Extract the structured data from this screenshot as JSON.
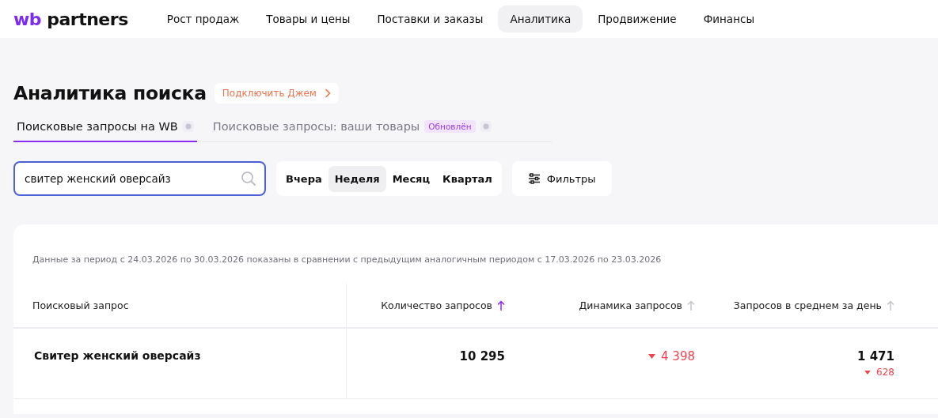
{
  "logo": {
    "brand": "wb",
    "name": "partners"
  },
  "nav": [
    {
      "label": "Рост продаж",
      "selected": false
    },
    {
      "label": "Товары и цены",
      "selected": false
    },
    {
      "label": "Поставки и заказы",
      "selected": false
    },
    {
      "label": "Аналитика",
      "selected": true
    },
    {
      "label": "Продвижение",
      "selected": false
    },
    {
      "label": "Финансы",
      "selected": false
    }
  ],
  "page_title": "Аналитика поиска",
  "promo_button": "Подключить Джем",
  "tabs": [
    {
      "label": "Поисковые запросы на WB",
      "selected": true
    },
    {
      "label": "Поисковые запросы: ваши товары",
      "selected": false,
      "badge": "Обновлён"
    }
  ],
  "search": {
    "value": "свитер женский оверсайз"
  },
  "periods": [
    {
      "label": "Вчера",
      "selected": false
    },
    {
      "label": "Неделя",
      "selected": true
    },
    {
      "label": "Месяц",
      "selected": false
    },
    {
      "label": "Квартал",
      "selected": false
    }
  ],
  "filters_button": "Фильтры",
  "period_note": "Данные за период с 24.03.2026 по 30.03.2026 показаны в сравнении с предыдущим аналогичным периодом с 17.03.2026 по 23.03.2026",
  "table": {
    "columns": [
      {
        "label": "Поисковый запрос"
      },
      {
        "label": "Количество запросов",
        "sorted": true
      },
      {
        "label": "Динамика запросов",
        "sorted": false
      },
      {
        "label": "Запросов в среднем за день",
        "sorted": false
      }
    ],
    "rows": [
      {
        "query": "Свитер женский оверсайз",
        "count": "10 295",
        "dynamics": {
          "value": "4 398",
          "decreased": true
        },
        "daily": {
          "value": "1 471",
          "change": "628",
          "decreased": true
        }
      }
    ]
  }
}
